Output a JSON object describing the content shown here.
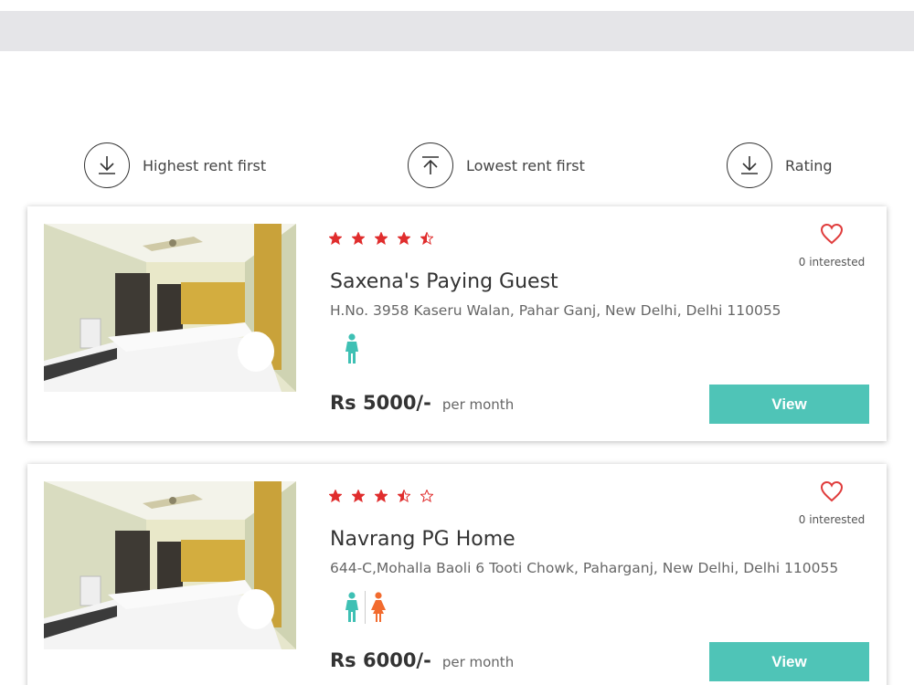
{
  "sort_options": [
    {
      "label": "Highest rent first",
      "icon": "arrow-down-icon"
    },
    {
      "label": "Lowest rent first",
      "icon": "arrow-up-icon"
    },
    {
      "label": "Rating",
      "icon": "arrow-down-icon"
    }
  ],
  "colors": {
    "accent": "#4fc4b7",
    "star": "#e02d2d",
    "heart": "#e03c3c",
    "male": "#3ec0b4",
    "female": "#f26b2e"
  },
  "listings": [
    {
      "name": "Saxena's Paying Guest",
      "address": "H.No. 3958 Kaseru Walan, Pahar Ganj, New Delhi, Delhi 110055",
      "rating": 4.5,
      "interested": "0 interested",
      "gender": [
        "male-icon"
      ],
      "price": "Rs 5000/-",
      "per": "per month",
      "button": "View"
    },
    {
      "name": "Navrang PG Home",
      "address": "644-C,Mohalla Baoli 6 Tooti Chowk, Paharganj, New Delhi, Delhi 110055",
      "rating": 3.5,
      "interested": "0 interested",
      "gender": [
        "male-icon",
        "female-icon"
      ],
      "price": "Rs 6000/-",
      "per": "per month",
      "button": "View"
    }
  ]
}
